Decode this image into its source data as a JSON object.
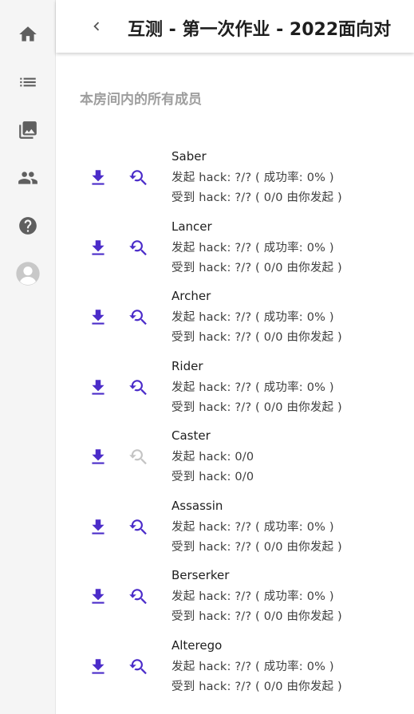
{
  "header": {
    "title": "互测 - 第一次作业 - 2022面向对"
  },
  "section_title": "本房间内的所有成员",
  "nav": [
    "home-icon",
    "list-icon",
    "gallery-icon",
    "people-icon",
    "help-icon",
    "avatar-icon"
  ],
  "colors": {
    "accent": "#4b2cc9",
    "disabled": "#c4c4c4",
    "rail": "#f5f5f5"
  },
  "members": [
    {
      "name": "Saber",
      "hack_out": "发起 hack: ?/? ( 成功率: 0% )",
      "hack_in": "受到 hack: ?/? ( 0/0 由你发起 )",
      "hack_enabled": true
    },
    {
      "name": "Lancer",
      "hack_out": "发起 hack: ?/? ( 成功率: 0% )",
      "hack_in": "受到 hack: ?/? ( 0/0 由你发起 )",
      "hack_enabled": true
    },
    {
      "name": "Archer",
      "hack_out": "发起 hack: ?/? ( 成功率: 0% )",
      "hack_in": "受到 hack: ?/? ( 0/0 由你发起 )",
      "hack_enabled": true
    },
    {
      "name": "Rider",
      "hack_out": "发起 hack: ?/? ( 成功率: 0% )",
      "hack_in": "受到 hack: ?/? ( 0/0 由你发起 )",
      "hack_enabled": true
    },
    {
      "name": "Caster",
      "hack_out": "发起 hack: 0/0",
      "hack_in": "受到 hack: 0/0",
      "hack_enabled": false
    },
    {
      "name": "Assassin",
      "hack_out": "发起 hack: ?/? ( 成功率: 0% )",
      "hack_in": "受到 hack: ?/? ( 0/0 由你发起 )",
      "hack_enabled": true
    },
    {
      "name": "Berserker",
      "hack_out": "发起 hack: ?/? ( 成功率: 0% )",
      "hack_in": "受到 hack: ?/? ( 0/0 由你发起 )",
      "hack_enabled": true
    },
    {
      "name": "Alterego",
      "hack_out": "发起 hack: ?/? ( 成功率: 0% )",
      "hack_in": "受到 hack: ?/? ( 0/0 由你发起 )",
      "hack_enabled": true
    }
  ]
}
